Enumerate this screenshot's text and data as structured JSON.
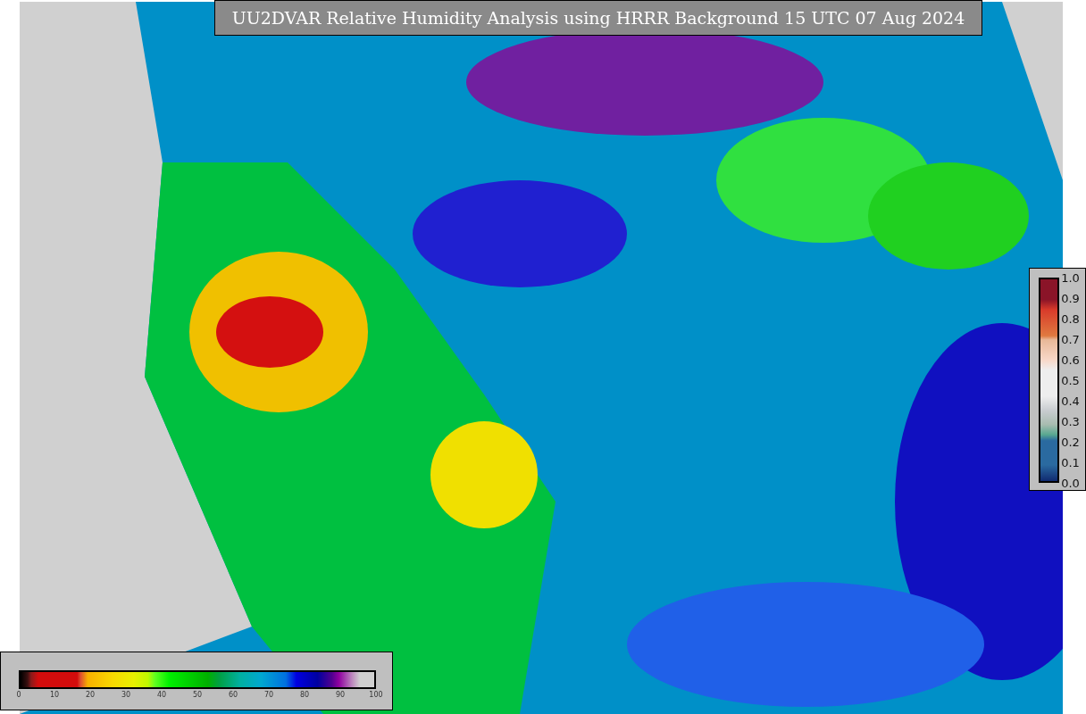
{
  "title": "UU2DVAR Relative Humidity Analysis using HRRR Background 15 UTC 07 Aug 2024",
  "humidity_colorbar": {
    "ticks": [
      "0",
      "10",
      "20",
      "30",
      "40",
      "50",
      "60",
      "70",
      "80",
      "90",
      "100"
    ]
  },
  "station_colorbar": {
    "ticks": [
      "1.0",
      "0.9",
      "0.8",
      "0.7",
      "0.6",
      "0.5",
      "0.4",
      "0.3",
      "0.2",
      "0.1",
      "0.0"
    ]
  }
}
